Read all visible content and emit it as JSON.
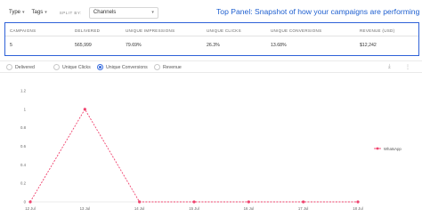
{
  "filters": {
    "type_label": "Type",
    "tags_label": "Tags",
    "split_by_label": "SPLIT BY:",
    "split_by_value": "Channels"
  },
  "panel_title": "Top Panel: Snapshot of how your campaigns are performing",
  "summary": {
    "headers": [
      "CAMPAIGNS",
      "DELIVERED",
      "UNIQUE IMPRESSIONS",
      "UNIQUE CLICKS",
      "UNIQUE CONVERSIONS",
      "REVENUE (USD)"
    ],
    "values": [
      "5",
      "565,999",
      "79.69%",
      "26.3%",
      "13.68%",
      "$12,242"
    ]
  },
  "tabs": [
    {
      "label": "Delivered",
      "selected": false
    },
    {
      "label": "Unique Clicks",
      "selected": false
    },
    {
      "label": "Unique Conversions",
      "selected": true
    },
    {
      "label": "Revenue",
      "selected": false
    }
  ],
  "icons": {
    "download": "download-icon",
    "more": "more-icon"
  },
  "colors": {
    "accent": "#2f62d8",
    "series": "#f0436e"
  },
  "chart_data": {
    "type": "line",
    "x": [
      "12 Jul",
      "13 Jul",
      "14 Jul",
      "15 Jul",
      "16 Jul",
      "17 Jul",
      "18 Jul"
    ],
    "series": [
      {
        "name": "WhatsApp",
        "values": [
          0,
          1,
          0,
          0,
          0,
          0,
          0
        ]
      }
    ],
    "ylim": [
      0,
      1.2
    ],
    "yticks": [
      "0",
      "0.2",
      "0.4",
      "0.6",
      "0.8",
      "1",
      "1.2"
    ],
    "legend_position": "right",
    "grid": false
  }
}
